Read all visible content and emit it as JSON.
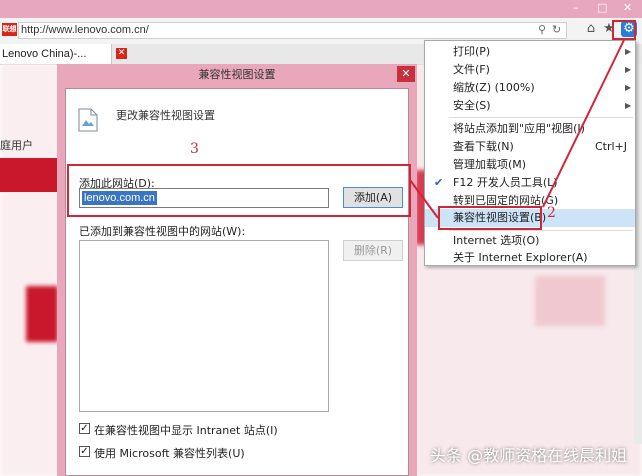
{
  "browser": {
    "url": "http://www.lenovo.com.cn/",
    "favicon_text": "联想",
    "tab_title": "Lenovo China)-...",
    "page_fragment": "庭用户",
    "window_button_icons": [
      "minimize-icon",
      "maximize-icon",
      "close-icon"
    ],
    "toolbar_icons": [
      "search-icon",
      "refresh-icon",
      "home-icon",
      "star-icon",
      "gear-icon"
    ]
  },
  "dialog": {
    "title": "兼容性视图设置",
    "heading": "更改兼容性视图设置",
    "add_site_label": "添加此网站(D):",
    "add_site_value": "lenovo.com.cn",
    "add_button": "添加(A)",
    "list_label": "已添加到兼容性视图中的网站(W):",
    "remove_button": "删除(R)",
    "checkboxes": [
      {
        "label": "在兼容性视图中显示 Intranet 站点(I)",
        "checked": true
      },
      {
        "label": "使用 Microsoft 兼容性列表(U)",
        "checked": true
      }
    ]
  },
  "tools_menu": {
    "items": [
      {
        "label": "打印(P)",
        "submenu": true
      },
      {
        "label": "文件(F)",
        "submenu": true
      },
      {
        "label": "缩放(Z) (100%)",
        "submenu": true
      },
      {
        "label": "安全(S)",
        "submenu": true
      },
      {
        "label": "将站点添加到\"应用\"视图(I)"
      },
      {
        "label": "查看下载(N)",
        "shortcut": "Ctrl+J"
      },
      {
        "label": "管理加载项(M)"
      },
      {
        "label": "F12 开发人员工具(L)",
        "checked": true
      },
      {
        "label": "转到已固定的网站(G)"
      },
      {
        "label": "兼容性视图设置(B)",
        "highlighted": true
      },
      {
        "label": "Internet 选项(O)"
      },
      {
        "label": "关于 Internet Explorer(A)"
      }
    ]
  },
  "annotations": {
    "step2": "2",
    "step3": "3"
  },
  "watermark": "头条 @教师资格在线晨利姐",
  "colors": {
    "title_bar": "#e7a7be",
    "annotation_red": "#d12638",
    "selection_blue": "#3a75c4",
    "menu_highlight": "#cde3f7"
  }
}
